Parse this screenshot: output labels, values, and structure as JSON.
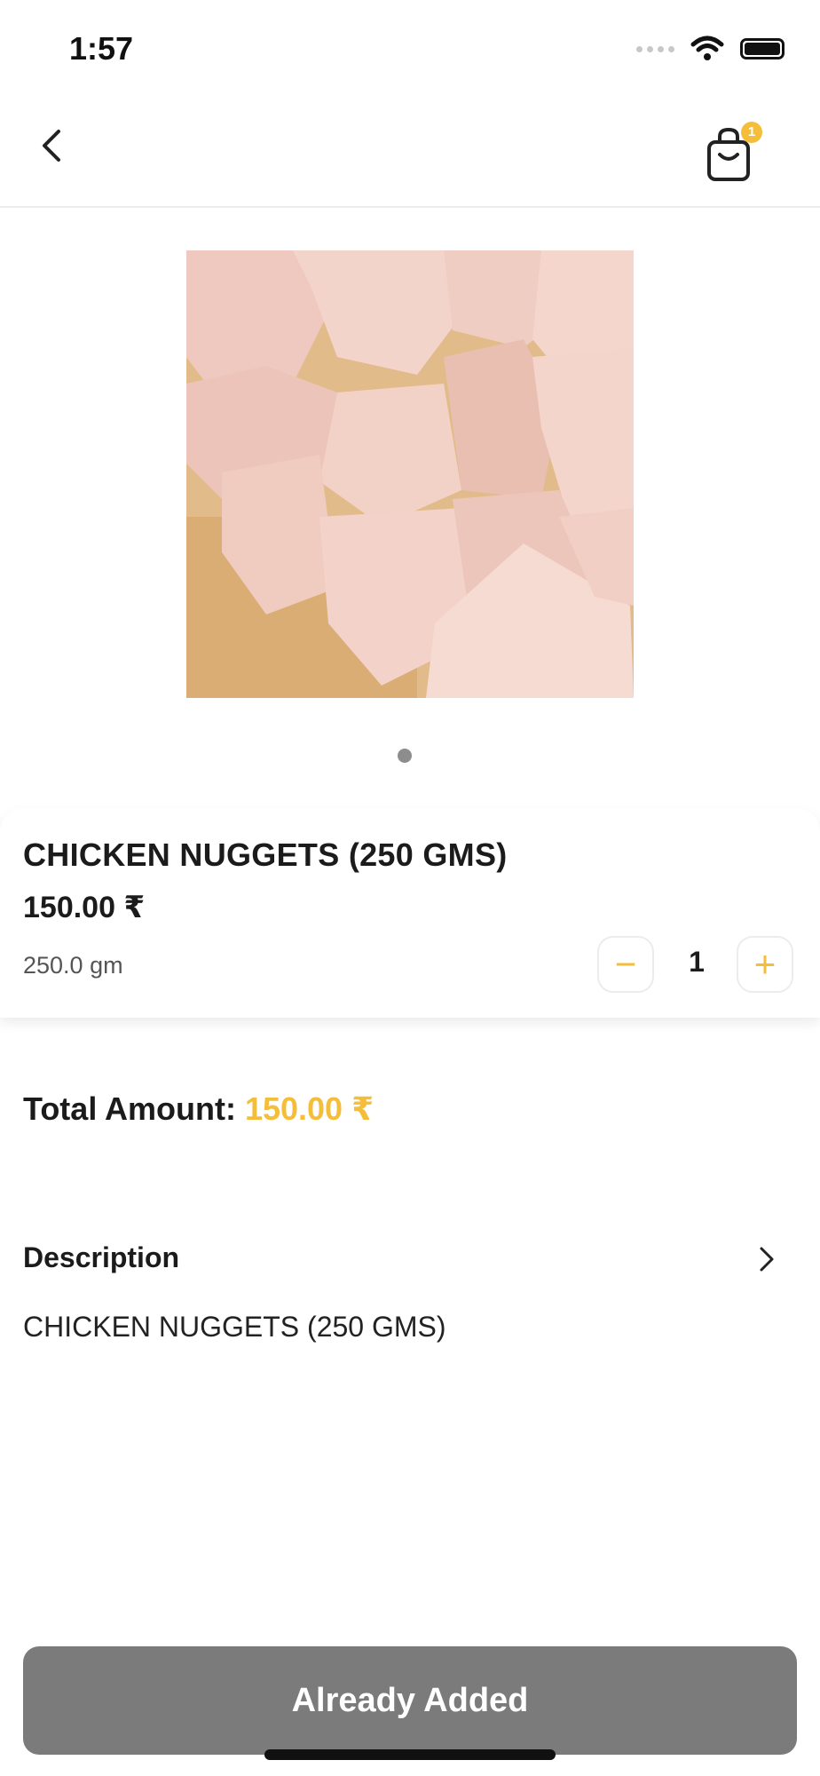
{
  "status_bar": {
    "time": "1:57"
  },
  "header": {
    "cart_count": "1"
  },
  "product": {
    "title": "CHICKEN NUGGETS (250 GMS)",
    "price": "150.00 ₹",
    "weight": "250.0 gm",
    "quantity": "1",
    "image_icon": "raw-chicken-cubes-photo",
    "carousel_dots": 1
  },
  "total": {
    "label": "Total Amount:",
    "value": "150.00 ₹"
  },
  "description": {
    "title": "Description",
    "text": "CHICKEN NUGGETS (250 GMS)"
  },
  "cta": {
    "label": "Already Added"
  },
  "colors": {
    "accent": "#f5be3a",
    "button_disabled": "#7b7b7b",
    "text": "#1b1b1b"
  }
}
